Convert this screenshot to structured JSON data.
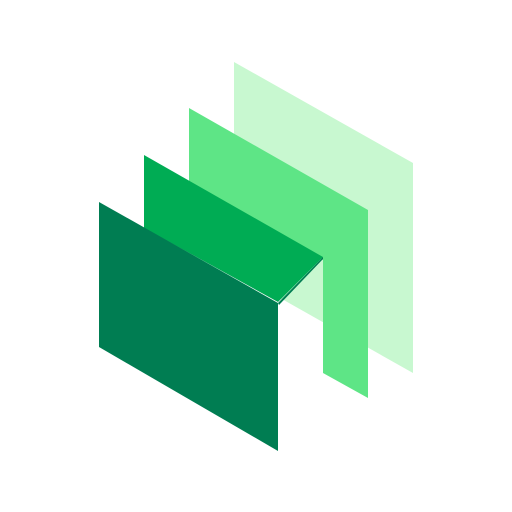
{
  "logo": {
    "icon": "layered-panels-icon",
    "background_color": "#ffffff",
    "layers": [
      {
        "name": "back-panel",
        "color": "#c8f8d0"
      },
      {
        "name": "mid-back-panel",
        "color": "#5ee586"
      },
      {
        "name": "mid-front-panel",
        "color": "#00ac54"
      },
      {
        "name": "front-panel",
        "color": "#007d52"
      }
    ]
  }
}
